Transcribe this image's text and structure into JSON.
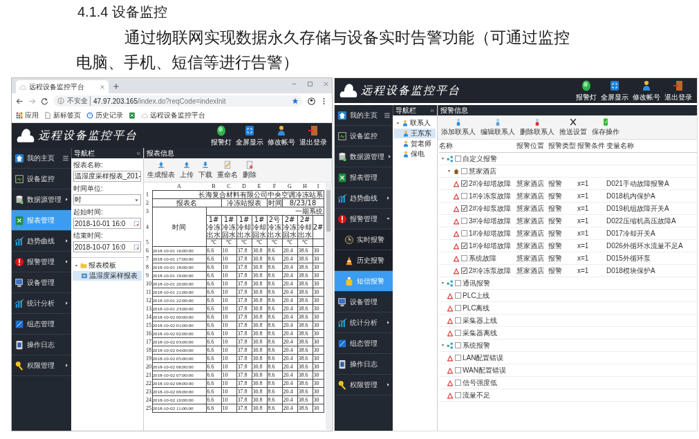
{
  "doc": {
    "heading": "4.1.4 设备监控",
    "paragraph": "通过物联网实现数据永久存储与设备实时告警功能（可通过监控电脑、手机、短信等进行告警）"
  },
  "browser": {
    "tab_title": "远程设备监控平台",
    "security": "不安全",
    "url_host": "47.97.203.165",
    "url_path": "/index.do?reqCode=indexInit",
    "bookmarks": [
      {
        "kind": "apps",
        "label": "应用"
      },
      {
        "kind": "page",
        "label": "新标签页"
      },
      {
        "kind": "history",
        "label": "历史记录"
      },
      {
        "kind": "sheet"
      },
      {
        "kind": "cloud",
        "label": "远程设备监控平台"
      }
    ]
  },
  "left_app": {
    "title": "远程设备监控平台",
    "actions": [
      {
        "kind": "lamp",
        "label": "报警灯"
      },
      {
        "kind": "fullscreen",
        "label": "全屏显示"
      },
      {
        "kind": "user",
        "label": "修改帐号"
      },
      {
        "kind": "exit",
        "label": "退出登录"
      }
    ],
    "sidebar": [
      {
        "kind": "home",
        "label": "我的主页",
        "submenu": false,
        "selected": false
      },
      {
        "kind": "monitor",
        "label": "设备监控",
        "submenu": false,
        "selected": false
      },
      {
        "kind": "database",
        "label": "数据源管理",
        "submenu": true,
        "selected": false
      },
      {
        "kind": "sheet",
        "label": "报表管理",
        "submenu": false,
        "selected": true
      },
      {
        "kind": "chart",
        "label": "趋势曲线",
        "submenu": true,
        "selected": false
      },
      {
        "kind": "alarm",
        "label": "报警管理",
        "submenu": true,
        "selected": false
      },
      {
        "kind": "device",
        "label": "设备管理",
        "submenu": false,
        "selected": false
      },
      {
        "kind": "chart",
        "label": "统计分析",
        "submenu": true,
        "selected": false
      },
      {
        "kind": "config",
        "label": "组态管理",
        "submenu": false,
        "selected": false
      },
      {
        "kind": "log",
        "label": "操作日志",
        "submenu": false,
        "selected": false
      },
      {
        "kind": "key",
        "label": "权限管理",
        "submenu": true,
        "selected": false
      }
    ],
    "nav": {
      "title": "导航栏",
      "fields": [
        {
          "kind": "text",
          "label": "报表名称:",
          "value": "温湿度采样报表_201-"
        },
        {
          "kind": "select",
          "label": "时间单位:",
          "value": "时"
        },
        {
          "kind": "date",
          "label": "起始时间:",
          "value": "2018-10-01 16:0"
        },
        {
          "kind": "date",
          "label": "结束时间:",
          "value": "2018-10-07 16:0"
        }
      ],
      "tree": [
        {
          "kind": "folder",
          "label": "报表模板",
          "expanded": true,
          "selected": false,
          "children": [
            {
              "kind": "report",
              "label": "温湿度采样报表",
              "selected": true
            }
          ]
        }
      ]
    },
    "report": {
      "title": "报表信息",
      "toolbar": [
        {
          "kind": "generate",
          "label": "生成报表"
        },
        {
          "kind": "upload",
          "label": "上传"
        },
        {
          "kind": "download",
          "label": "下载"
        },
        {
          "kind": "rename",
          "label": "重命名"
        },
        {
          "kind": "delete",
          "label": "删除"
        }
      ],
      "sheet": {
        "columns": [
          "A",
          "B",
          "C",
          "D",
          "E",
          "F",
          "G",
          "H",
          "I"
        ],
        "title_row": {
          "num": "1",
          "text": "长海复合材料有限公司中央空调冷冻站系"
        },
        "info_row": {
          "num": "2",
          "cells": [
            "报表名",
            "冷冻站报表",
            "时间",
            "8/23/18"
          ]
        },
        "group_row": {
          "num": "3",
          "text": "一期系统"
        },
        "time_label": "时间",
        "header_row": {
          "num": "4",
          "cells": [
            "1#冷冻出水",
            "1#冷冻回水",
            "1#冷却出水",
            "1#冷却回水",
            "2号冷冻出水",
            "2#冷冻回水",
            "2#冷却出水",
            "2#"
          ]
        },
        "unit_row": {
          "num": "5",
          "cells": [
            "℃",
            "℃",
            "℃",
            "℃",
            "℃",
            "℃",
            "℃"
          ]
        },
        "rows": [
          {
            "num": "6",
            "cells": [
              "2018-10-01 16:00:00",
              "6.6",
              "10",
              "37.8",
              "30.8",
              "8.6",
              "20.4",
              "38.6",
              "30"
            ]
          },
          {
            "num": "7",
            "cells": [
              "2018-10-01 17:00:00",
              "6.6",
              "10",
              "37.8",
              "30.8",
              "8.6",
              "20.4",
              "38.6",
              "30"
            ]
          },
          {
            "num": "8",
            "cells": [
              "2018-10-01 18:00:00",
              "6.6",
              "10",
              "37.8",
              "30.8",
              "8.6",
              "20.4",
              "38.6",
              "30"
            ]
          },
          {
            "num": "9",
            "cells": [
              "2018-10-01 19:00:00",
              "6.6",
              "10",
              "37.8",
              "30.8",
              "8.6",
              "20.4",
              "38.6",
              "30"
            ]
          },
          {
            "num": "10",
            "cells": [
              "2018-10-01 20:00:00",
              "6.6",
              "10",
              "37.8",
              "30.8",
              "8.6",
              "20.4",
              "38.6",
              "30"
            ]
          },
          {
            "num": "11",
            "cells": [
              "2018-10-01 21:00:00",
              "6.6",
              "10",
              "37.8",
              "30.8",
              "8.6",
              "20.4",
              "38.6",
              "30"
            ]
          },
          {
            "num": "12",
            "cells": [
              "2018-10-01 22:00:00",
              "6.6",
              "10",
              "37.8",
              "30.8",
              "8.6",
              "20.4",
              "38.6",
              "30"
            ]
          },
          {
            "num": "13",
            "cells": [
              "2018-10-01 23:00:00",
              "6.6",
              "10",
              "37.8",
              "30.8",
              "8.6",
              "20.4",
              "38.6",
              "30"
            ]
          },
          {
            "num": "14",
            "cells": [
              "2018-10-02 00:00:00",
              "6.6",
              "10",
              "37.8",
              "30.8",
              "8.6",
              "20.4",
              "38.6",
              "30"
            ]
          },
          {
            "num": "15",
            "cells": [
              "2018-10-02 01:00:00",
              "6.6",
              "10",
              "37.8",
              "30.8",
              "8.6",
              "20.4",
              "38.6",
              "30"
            ]
          },
          {
            "num": "16",
            "cells": [
              "2018-10-02 02:00:00",
              "6.6",
              "10",
              "37.8",
              "30.8",
              "8.6",
              "20.4",
              "38.6",
              "30"
            ]
          },
          {
            "num": "17",
            "cells": [
              "2018-10-02 03:00:00",
              "6.6",
              "10",
              "37.8",
              "30.8",
              "8.6",
              "20.4",
              "38.6",
              "30"
            ]
          },
          {
            "num": "18",
            "cells": [
              "2018-10-02 04:00:00",
              "6.6",
              "10",
              "37.8",
              "30.8",
              "8.6",
              "20.4",
              "38.6",
              "30"
            ]
          },
          {
            "num": "19",
            "cells": [
              "2018-10-02 05:00:00",
              "6.6",
              "10",
              "37.8",
              "30.8",
              "8.6",
              "20.4",
              "38.6",
              "30"
            ]
          },
          {
            "num": "20",
            "cells": [
              "2018-10-02 06:00:00",
              "6.6",
              "10",
              "37.8",
              "30.8",
              "8.6",
              "20.4",
              "38.6",
              "30"
            ]
          },
          {
            "num": "21",
            "cells": [
              "2018-10-02 07:00:00",
              "6.6",
              "10",
              "37.8",
              "30.8",
              "8.6",
              "20.4",
              "38.6",
              "30"
            ]
          },
          {
            "num": "22",
            "cells": [
              "2018-10-02 08:00:00",
              "6.6",
              "10",
              "37.8",
              "30.8",
              "8.6",
              "20.4",
              "38.6",
              "30"
            ]
          },
          {
            "num": "23",
            "cells": [
              "2018-10-02 09:00:00",
              "6.6",
              "10",
              "37.8",
              "30.8",
              "8.6",
              "20.4",
              "38.6",
              "30"
            ]
          },
          {
            "num": "24",
            "cells": [
              "2018-10-02 10:00:00",
              "6.6",
              "10",
              "37.8",
              "30.8",
              "8.6",
              "20.4",
              "38.6",
              "30"
            ]
          },
          {
            "num": "25",
            "cells": [
              "2018-10-02 11:00:00",
              "6.6",
              "10",
              "37.8",
              "30.8",
              "8.6",
              "20.4",
              "38.6",
              "30"
            ]
          }
        ]
      }
    }
  },
  "right_app": {
    "title": "远程设备监控平台",
    "actions": [
      {
        "kind": "lamp",
        "label": "报警灯"
      },
      {
        "kind": "fullscreen",
        "label": "全屏显示"
      },
      {
        "kind": "user",
        "label": "修改帐号"
      },
      {
        "kind": "exit",
        "label": "退出登录"
      }
    ],
    "sidebar": [
      {
        "kind": "home",
        "label": "我的主页",
        "submenu": false,
        "selected": false
      },
      {
        "kind": "monitor",
        "label": "设备监控",
        "submenu": false,
        "selected": false
      },
      {
        "kind": "database",
        "label": "数据源管理",
        "submenu": true,
        "selected": false
      },
      {
        "kind": "sheet",
        "label": "报表管理",
        "submenu": false,
        "selected": false
      },
      {
        "kind": "chart",
        "label": "趋势曲线",
        "submenu": true,
        "selected": false
      },
      {
        "kind": "alarm",
        "label": "报警管理",
        "submenu": true,
        "expanded": true,
        "selected": false,
        "children": [
          {
            "kind": "realtime",
            "label": "实时报警",
            "selected": false
          },
          {
            "kind": "history",
            "label": "历史报警",
            "selected": false
          },
          {
            "kind": "sms",
            "label": "短信报警",
            "selected": true
          }
        ]
      },
      {
        "kind": "device",
        "label": "设备管理",
        "submenu": false,
        "selected": false
      },
      {
        "kind": "chart",
        "label": "统计分析",
        "submenu": true,
        "selected": false
      },
      {
        "kind": "config",
        "label": "组态管理",
        "submenu": false,
        "selected": false
      },
      {
        "kind": "log",
        "label": "操作日志",
        "submenu": false,
        "selected": false
      },
      {
        "kind": "key",
        "label": "权限管理",
        "submenu": true,
        "selected": false
      }
    ],
    "nav": {
      "title": "导航栏",
      "tree": [
        {
          "kind": "contacts",
          "label": "联系人",
          "expanded": true,
          "selected": false,
          "children": [
            {
              "kind": "contact",
              "label": "王东东",
              "selected": true
            },
            {
              "kind": "contact",
              "label": "贺老师",
              "selected": false
            },
            {
              "kind": "contact",
              "label": "保电",
              "selected": false
            }
          ]
        }
      ]
    },
    "alarm": {
      "title": "报警信息",
      "toolbar": [
        {
          "kind": "add",
          "label": "添加联系人"
        },
        {
          "kind": "edit",
          "label": "编辑联系人"
        },
        {
          "kind": "remove",
          "label": "删除联系人"
        },
        {
          "kind": "push",
          "label": "推送设置"
        },
        {
          "kind": "save",
          "label": "保存操作"
        }
      ],
      "columns": [
        "名称",
        "报警位置",
        "报警类型",
        "报警条件",
        "变量名称"
      ],
      "tree": [
        {
          "kind": "group",
          "name": "自定义报警",
          "checked": false,
          "expanded": true,
          "children": [
            {
              "kind": "site",
              "name": "慧家酒店",
              "checked": false,
              "expanded": true,
              "children": [
                {
                  "kind": "alarm",
                  "name": "2#冷却塔故障",
                  "checked": true,
                  "cells": [
                    "慧家酒店",
                    "报警",
                    "x=1",
                    "D021手动故障报警A"
                  ]
                },
                {
                  "kind": "alarm",
                  "name": "1#冷冻泵故障",
                  "checked": false,
                  "cells": [
                    "慧家酒店",
                    "报警",
                    "x=1",
                    "D018机内保护A"
                  ]
                },
                {
                  "kind": "alarm",
                  "name": "2#冷却泵故障",
                  "checked": true,
                  "cells": [
                    "慧家酒店",
                    "报警",
                    "x=1",
                    "D019机组故障开关A"
                  ]
                },
                {
                  "kind": "alarm",
                  "name": "3#冷却塔故障",
                  "checked": false,
                  "cells": [
                    "慧家酒店",
                    "报警",
                    "x=1",
                    "D022压缩机高压故障A"
                  ]
                },
                {
                  "kind": "alarm",
                  "name": "1#冷却塔故障",
                  "checked": false,
                  "cells": [
                    "慧家酒店",
                    "报警",
                    "x=1",
                    "D017冷却开关A"
                  ]
                },
                {
                  "kind": "alarm",
                  "name": "1#冷却塔故障",
                  "checked": true,
                  "cells": [
                    "慧家酒店",
                    "报警",
                    "x=1",
                    "D026外循环水流量不足A"
                  ]
                },
                {
                  "kind": "alarm",
                  "name": "系统故障",
                  "checked": false,
                  "cells": [
                    "慧家酒店",
                    "报警",
                    "x=1",
                    "D015外循环泵"
                  ]
                },
                {
                  "kind": "alarm",
                  "name": "2#冷冻泵故障",
                  "checked": true,
                  "cells": [
                    "慧家酒店",
                    "报警",
                    "x=1",
                    "D018模块保护A"
                  ]
                }
              ]
            }
          ]
        },
        {
          "kind": "group",
          "name": "通讯报警",
          "checked": false,
          "expanded": true,
          "children": [
            {
              "kind": "alarm",
              "name": "PLC上线",
              "checked": false
            },
            {
              "kind": "alarm",
              "name": "PLC离线",
              "checked": false
            },
            {
              "kind": "alarm",
              "name": "采集器上线",
              "checked": false
            },
            {
              "kind": "alarm",
              "name": "采集器离线",
              "checked": false
            }
          ]
        },
        {
          "kind": "group",
          "name": "系统报警",
          "checked": false,
          "expanded": true,
          "children": [
            {
              "kind": "alarm",
              "name": "LAN配置错误",
              "checked": false
            },
            {
              "kind": "alarm",
              "name": "WAN配置错误",
              "checked": false
            },
            {
              "kind": "alarm",
              "name": "信号强度低",
              "checked": false
            },
            {
              "kind": "alarm",
              "name": "流量不足",
              "checked": false
            }
          ]
        }
      ]
    }
  }
}
